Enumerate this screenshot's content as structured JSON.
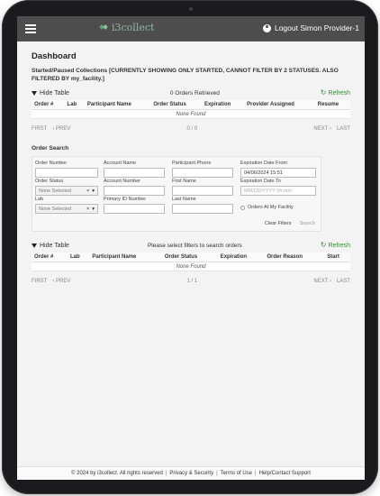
{
  "header": {
    "brand": "i3collect",
    "logout_label": "Logout Simon Provider-1"
  },
  "dashboard": {
    "title": "Dashboard",
    "filter_note": "Started/Paused Collections [CURRENTLY SHOWING ONLY STARTED, CANNOT FILTER BY 2 STATUSES. ALSO FILTERED BY my_facility.]"
  },
  "collections_table": {
    "hide_label": "Hide Table",
    "status_msg": "0 Orders Retrieved",
    "refresh_label": "Refresh",
    "columns": [
      "Order #",
      "Lab",
      "Participant Name",
      "Order Status",
      "Expiration",
      "Provider Assigned",
      "Resume"
    ],
    "empty_msg": "None Found",
    "pager": {
      "first": "FIRST",
      "prev": "PREV",
      "page": "0 / 0",
      "next": "NEXT",
      "last": "LAST"
    }
  },
  "order_search": {
    "title": "Order Search",
    "order_number": {
      "label": "Order Number",
      "value": ""
    },
    "account_name": {
      "label": "Account Name",
      "value": ""
    },
    "participant_phone": {
      "label": "Participant Phone",
      "value": ""
    },
    "exp_from": {
      "label": "Expiration Date From",
      "value": "04/06/2024 15:51"
    },
    "order_status": {
      "label": "Order Status",
      "value": "None Selected"
    },
    "account_number": {
      "label": "Account Number",
      "value": ""
    },
    "first_name": {
      "label": "First Name",
      "value": ""
    },
    "exp_to": {
      "label": "Expiration Date To",
      "placeholder": "MM/DD/YYYY hh:mm"
    },
    "lab": {
      "label": "Lab",
      "value": "None Selected"
    },
    "primary_id": {
      "label": "Primary ID Number",
      "value": ""
    },
    "last_name": {
      "label": "Last Name",
      "value": ""
    },
    "facility_checkbox": "Orders At My Facility",
    "clear_label": "Clear Filters",
    "search_label": "Search",
    "select_clear_glyph": "×",
    "select_caret_glyph": "▾"
  },
  "search_table": {
    "hide_label": "Hide Table",
    "status_msg": "Please select filters to search orders",
    "refresh_label": "Refresh",
    "columns": [
      "Order #",
      "Lab",
      "Participant Name",
      "Order Status",
      "Expiration",
      "Order Reason",
      "Start"
    ],
    "empty_msg": "None Found",
    "pager": {
      "first": "FIRST",
      "prev": "PREV",
      "page": "1 / 1",
      "next": "NEXT",
      "last": "LAST"
    }
  },
  "footer": {
    "copyright": "© 2024 by i3collect. All rights reserved",
    "privacy": "Privacy & Security",
    "terms": "Terms of Use",
    "help": "Help/Contact Support",
    "separator": "|"
  },
  "colors": {
    "topbar": "#4d4d4d",
    "refresh": "#3a8a3a",
    "brand": "#5fa37e"
  }
}
